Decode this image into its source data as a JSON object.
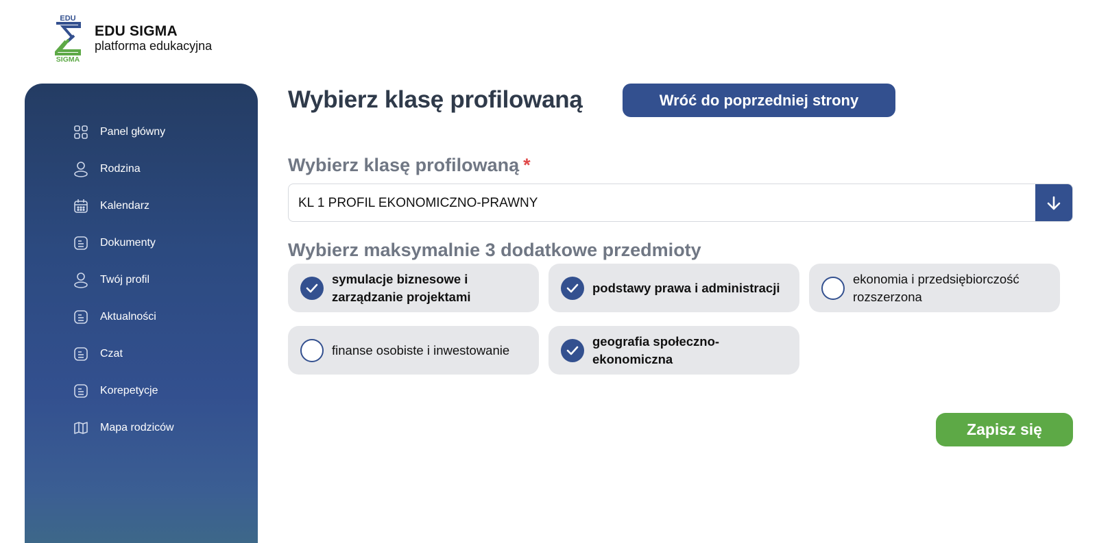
{
  "logo": {
    "top_text": "EDU",
    "bottom_text": "SIGMA",
    "title": "EDU SIGMA",
    "subtitle": "platforma edukacyjna"
  },
  "sidebar": {
    "items": [
      {
        "label": "Panel główny",
        "icon": "dashboard-icon"
      },
      {
        "label": "Rodzina",
        "icon": "user-icon"
      },
      {
        "label": "Kalendarz",
        "icon": "calendar-icon"
      },
      {
        "label": "Dokumenty",
        "icon": "document-icon"
      },
      {
        "label": "Twój profil",
        "icon": "user-icon"
      },
      {
        "label": "Aktualności",
        "icon": "document-icon"
      },
      {
        "label": "Czat",
        "icon": "document-icon"
      },
      {
        "label": "Korepetycje",
        "icon": "document-icon"
      },
      {
        "label": "Mapa rodziców",
        "icon": "map-icon"
      }
    ]
  },
  "header": {
    "title": "Wybierz klasę profilowaną",
    "back_label": "Wróć do poprzedniej strony"
  },
  "form": {
    "class_label": "Wybierz klasę profilowaną",
    "required_mark": "*",
    "class_value": "KL 1 PROFIL EKONOMICZNO-PRAWNY",
    "subjects_label": "Wybierz maksymalnie 3 dodatkowe przedmioty",
    "options": [
      {
        "label": "symulacje biznesowe i zarządzanie projektami",
        "checked": true
      },
      {
        "label": "podstawy prawa i administracji",
        "checked": true
      },
      {
        "label": "ekonomia i przedsiębiorczość rozszerzona",
        "checked": false
      },
      {
        "label": "finanse osobiste i inwestowanie",
        "checked": false
      },
      {
        "label": "geografia społeczno-ekonomiczna",
        "checked": true
      }
    ],
    "submit_label": "Zapisz się"
  },
  "colors": {
    "primary": "#33508f",
    "accent_green": "#5da946",
    "logo_blue": "#33508f",
    "logo_green": "#5da946",
    "required": "#e04a4a"
  }
}
